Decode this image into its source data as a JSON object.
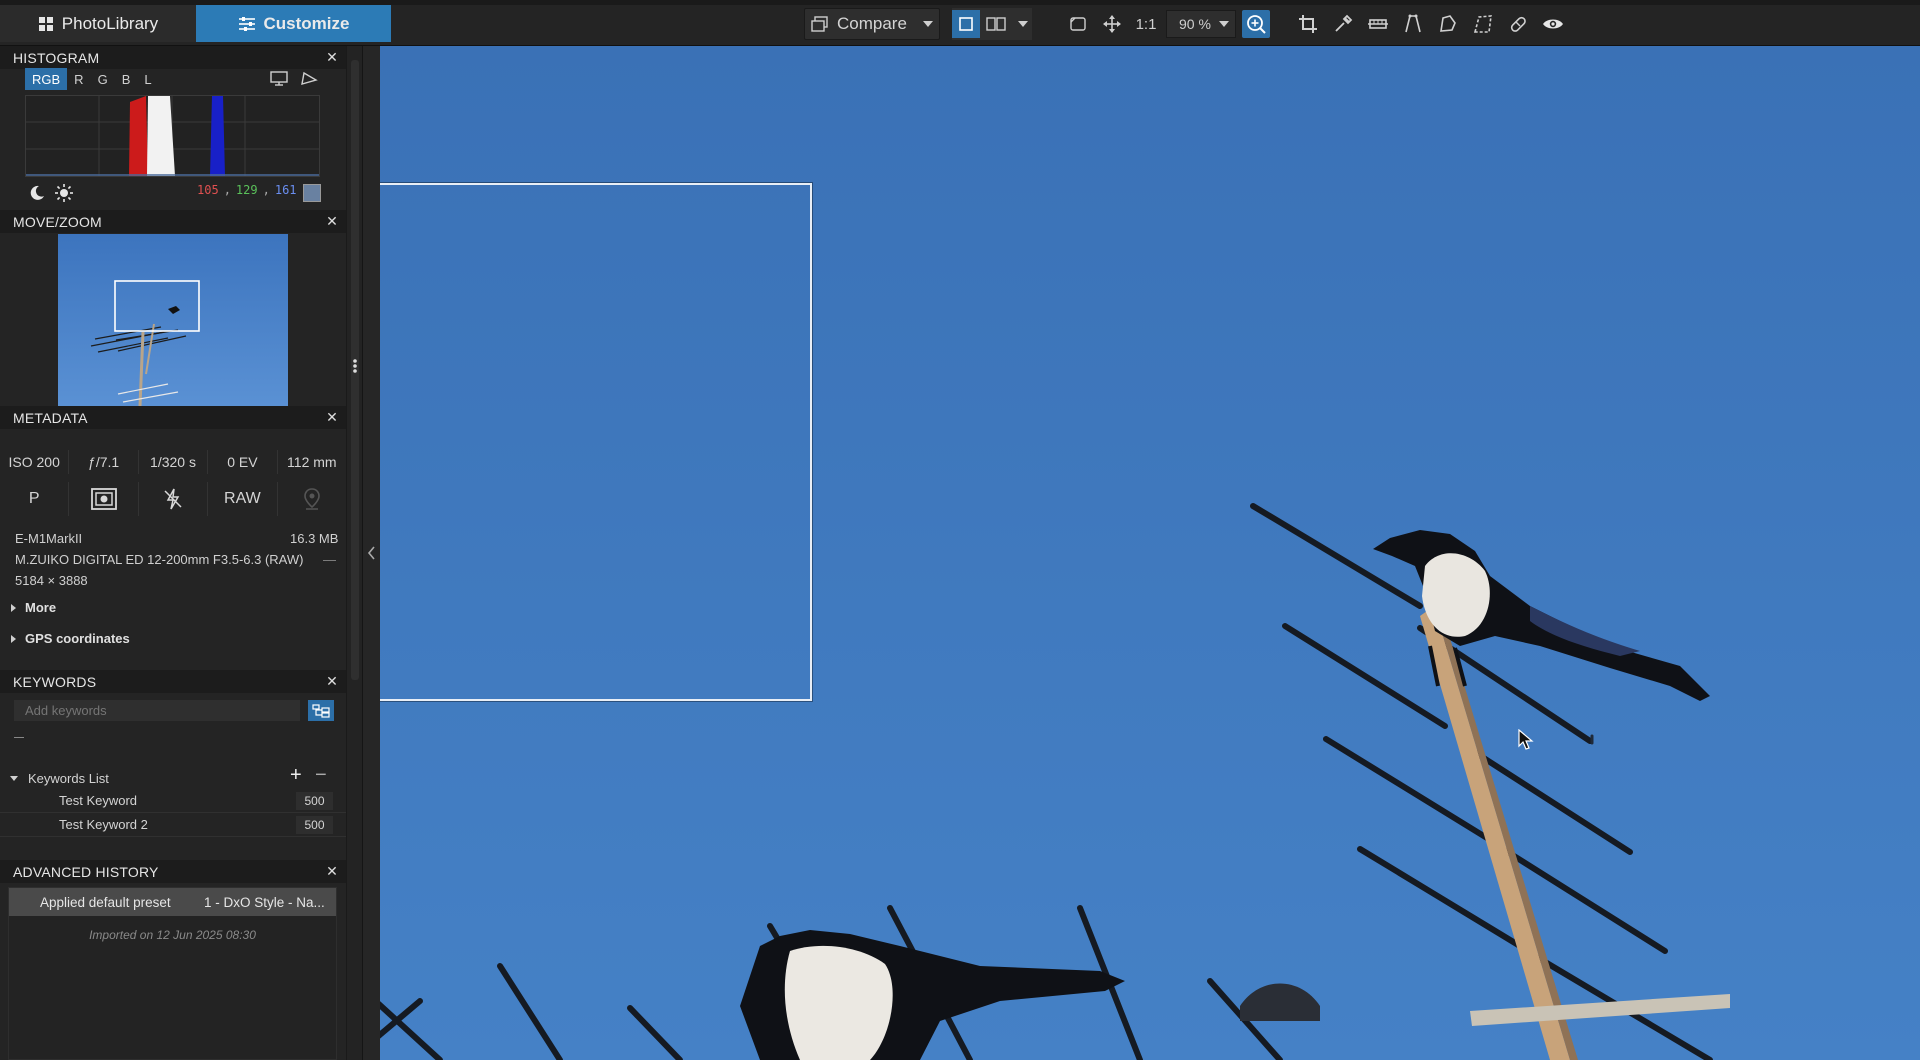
{
  "topbar": {
    "tabs": [
      {
        "label": "PhotoLibrary",
        "icon": "grid-icon",
        "active": false
      },
      {
        "label": "Customize",
        "icon": "sliders-icon",
        "active": true
      }
    ],
    "compare_label": "Compare",
    "one_to_one_label": "1:1",
    "zoom_value": "90 %",
    "active_color": "#2c7bb6"
  },
  "histogram": {
    "title": "HISTOGRAM",
    "channels": [
      "RGB",
      "R",
      "G",
      "B",
      "L"
    ],
    "active_channel": "RGB",
    "readout": {
      "r": "105",
      "g": "129",
      "b": "161"
    },
    "swatch_color": "#6981a1"
  },
  "movezoom": {
    "title": "MOVE/ZOOM"
  },
  "metadata": {
    "title": "METADATA",
    "iso": "ISO 200",
    "aperture": "ƒ/7.1",
    "shutter": "1/320 s",
    "ev": "0 EV",
    "focal": "112 mm",
    "mode": "P",
    "format": "RAW",
    "camera": "E-M1MarkII",
    "filesize": "16.3 MB",
    "lens": "M.ZUIKO DIGITAL ED 12-200mm F3.5-6.3 (RAW)",
    "lens_extra": "—",
    "dimensions": "5184 × 3888",
    "more_label": "More",
    "gps_label": "GPS coordinates"
  },
  "keywords": {
    "title": "KEYWORDS",
    "placeholder": "Add keywords",
    "list_label": "Keywords List",
    "items": [
      {
        "name": "Test Keyword",
        "count": "500"
      },
      {
        "name": "Test Keyword 2",
        "count": "500"
      }
    ]
  },
  "history": {
    "title": "ADVANCED HISTORY",
    "item_action": "Applied default preset",
    "item_preset": "1 - DxO Style - Na...",
    "imported": "Imported on 12 Jun 2025 08:30"
  }
}
